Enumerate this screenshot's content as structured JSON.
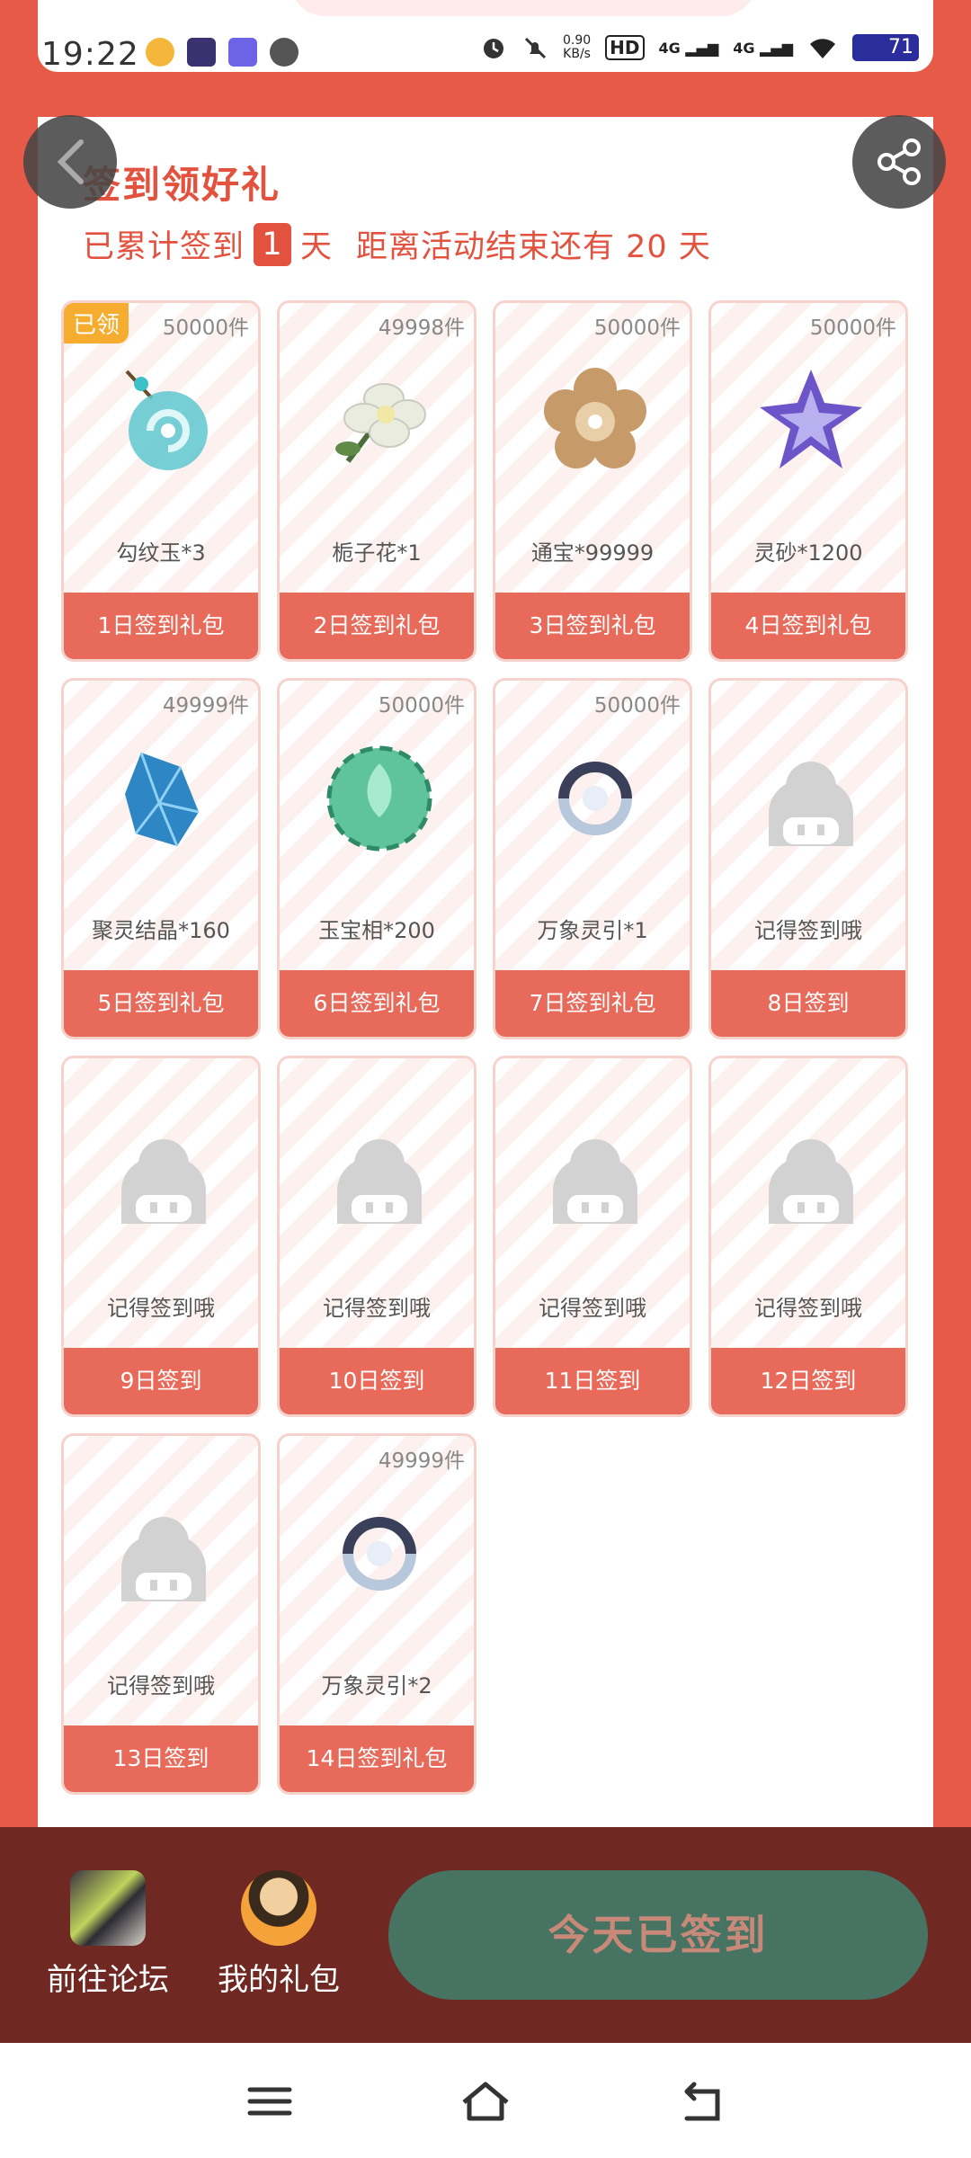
{
  "status_bar": {
    "time": "19:22",
    "net_speed_value": "0.90",
    "net_speed_unit": "KB/s",
    "hd_label": "HD",
    "signal_1": "4G",
    "signal_2": "4G",
    "battery": "71"
  },
  "header": {
    "title": "签到领好礼",
    "progress_prefix": "已累计签到",
    "signed_days": "1",
    "progress_unit": "天",
    "remaining_text": "距离活动结束还有 20 天"
  },
  "gifts": [
    {
      "day_label": "1日签到礼包",
      "item": "勾纹玉*3",
      "stock": "50000件",
      "badge": "已领",
      "icon": "jade-pendant-icon",
      "color": "#5ec8cf"
    },
    {
      "day_label": "2日签到礼包",
      "item": "栀子花*1",
      "stock": "49998件",
      "icon": "gardenia-icon",
      "color": "#e9ecdf"
    },
    {
      "day_label": "3日签到礼包",
      "item": "通宝*99999",
      "stock": "50000件",
      "icon": "coin-flower-icon",
      "color": "#c79a6a"
    },
    {
      "day_label": "4日签到礼包",
      "item": "灵砂*1200",
      "stock": "50000件",
      "icon": "star-crystal-icon",
      "color": "#6b55c8"
    },
    {
      "day_label": "5日签到礼包",
      "item": "聚灵结晶*160",
      "stock": "49999件",
      "icon": "blue-crystal-icon",
      "color": "#2e86c4"
    },
    {
      "day_label": "6日签到礼包",
      "item": "玉宝相*200",
      "stock": "50000件",
      "icon": "jade-flower-icon",
      "color": "#5fc39b"
    },
    {
      "day_label": "7日签到礼包",
      "item": "万象灵引*1",
      "stock": "50000件",
      "icon": "spiral-ring-icon",
      "color": "#3a3f5a"
    },
    {
      "day_label": "8日签到",
      "item": "记得签到哦",
      "stock": "",
      "icon": "placeholder-mascot-icon",
      "color": "#d2d2d2"
    },
    {
      "day_label": "9日签到",
      "item": "记得签到哦",
      "stock": "",
      "icon": "placeholder-mascot-icon",
      "color": "#d2d2d2"
    },
    {
      "day_label": "10日签到",
      "item": "记得签到哦",
      "stock": "",
      "icon": "placeholder-mascot-icon",
      "color": "#d2d2d2"
    },
    {
      "day_label": "11日签到",
      "item": "记得签到哦",
      "stock": "",
      "icon": "placeholder-mascot-icon",
      "color": "#d2d2d2"
    },
    {
      "day_label": "12日签到",
      "item": "记得签到哦",
      "stock": "",
      "icon": "placeholder-mascot-icon",
      "color": "#d2d2d2"
    },
    {
      "day_label": "13日签到",
      "item": "记得签到哦",
      "stock": "",
      "icon": "placeholder-mascot-icon",
      "color": "#d2d2d2"
    },
    {
      "day_label": "14日签到礼包",
      "item": "万象灵引*2",
      "stock": "49999件",
      "icon": "spiral-ring-icon",
      "color": "#3a3f5a"
    }
  ],
  "bottom": {
    "forum_label": "前往论坛",
    "gifts_label": "我的礼包",
    "signed_button": "今天已签到"
  },
  "colors": {
    "brand_red": "#e65a47",
    "day_bar": "#e86a5a",
    "claimed_badge": "#f6ad2f",
    "signed_button_bg": "#477363",
    "bottom_bar_bg": "#6f2822"
  }
}
